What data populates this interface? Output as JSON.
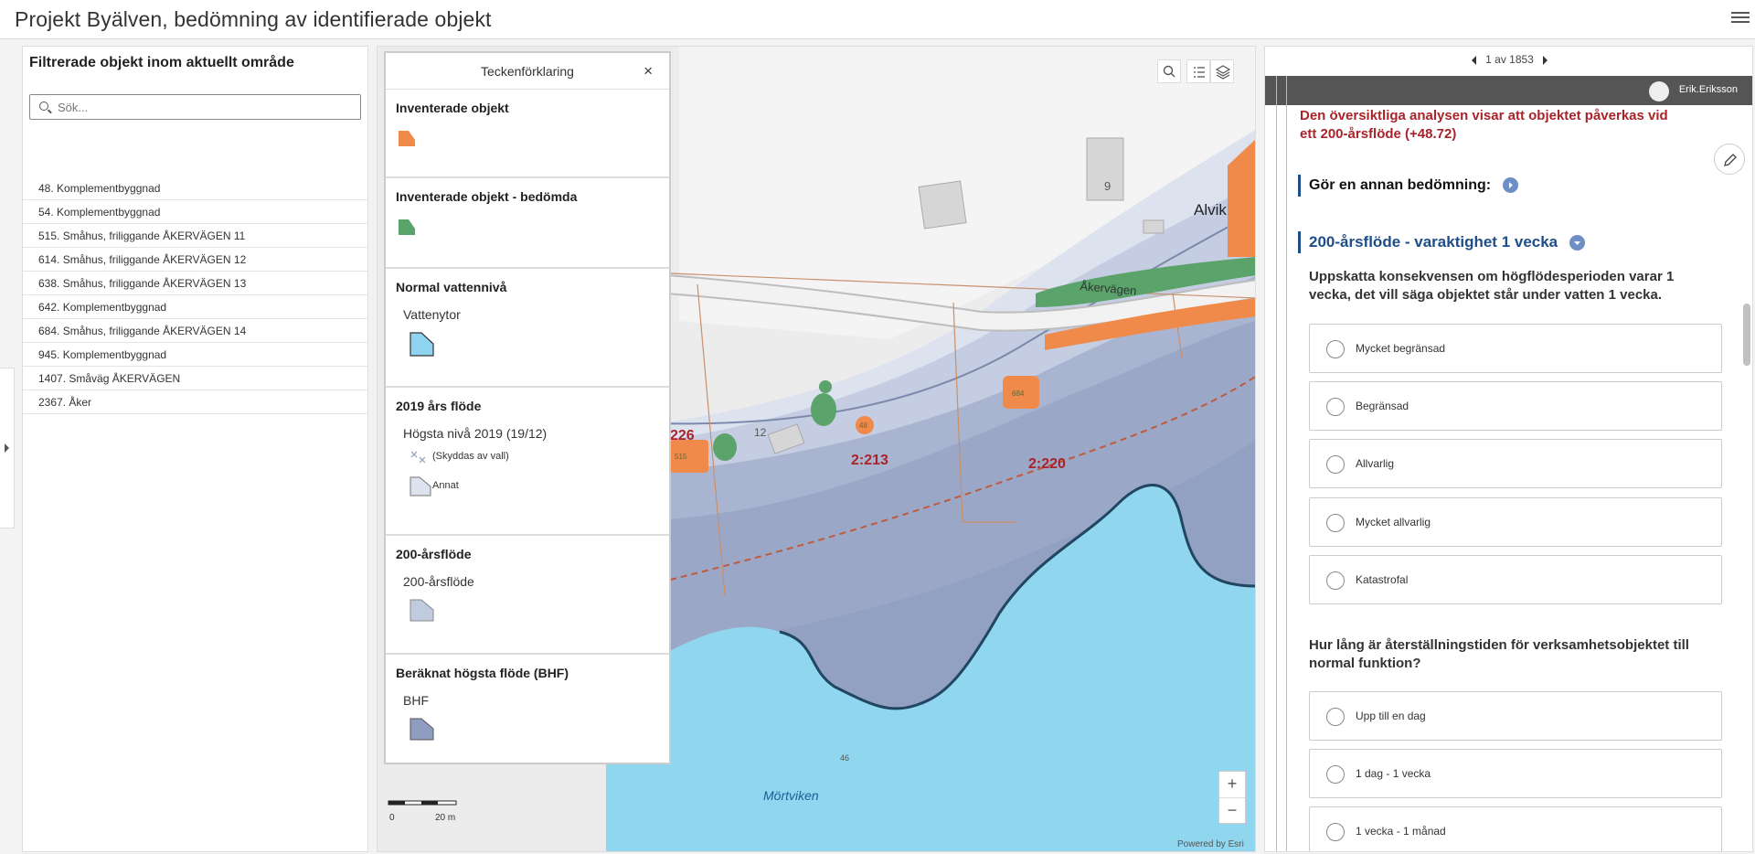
{
  "app": {
    "title": "Projekt Byälven, bedömning av identifierade objekt"
  },
  "list_panel": {
    "title": "Filtrerade objekt inom aktuellt område",
    "search_placeholder": "Sök...",
    "items": [
      "48. Komplementbyggnad",
      "54. Komplementbyggnad",
      "515. Småhus, friliggande ÅKERVÄGEN 11",
      "614. Småhus, friliggande ÅKERVÄGEN 12",
      "638. Småhus, friliggande ÅKERVÄGEN 13",
      "642. Komplementbyggnad",
      "684. Småhus, friliggande ÅKERVÄGEN 14",
      "945. Komplementbyggnad",
      "1407. Småväg ÅKERVÄGEN",
      "2367. Åker"
    ]
  },
  "legend": {
    "title": "Teckenförklaring",
    "close": "×",
    "sections": {
      "s1": {
        "title": "Inventerade objekt",
        "color": "#f08a4b"
      },
      "s2": {
        "title": "Inventerade objekt - bedömda",
        "color": "#5aa36b"
      },
      "s3": {
        "title": "Normal vattennivå",
        "sub": "Vattenytor",
        "color": "#8fd3f0"
      },
      "s4": {
        "title": "2019 års flöde",
        "sub": "Högsta nivå 2019 (19/12)",
        "item1": "(Skyddas av vall)",
        "item2": "Annat"
      },
      "s5": {
        "title": "200-årsflöde",
        "sub": "200-årsflöde",
        "color": "#c0cbe0"
      },
      "s6": {
        "title": "Beräknat högsta flöde (BHF)",
        "sub": "BHF",
        "color": "#8e9dc0"
      }
    }
  },
  "map": {
    "labels": {
      "road": "Åkervägen",
      "place": "Alvik",
      "bay": "Mörtviken",
      "parcel_226": "226",
      "parcel_213": "2:213",
      "parcel_220": "2:220",
      "house_9": "9",
      "house_12": "12",
      "obj_684": "684",
      "obj_48": "48",
      "obj_515": "515",
      "depth_46": "46"
    },
    "scale": {
      "start": "0",
      "end": "20 m"
    },
    "attribution": "Powered by Esri",
    "zoom_in": "+",
    "zoom_out": "−"
  },
  "right_panel": {
    "pager": "1 av 1853",
    "user": "Erik.Eriksson",
    "analysis": "Den översiktliga analysen visar att objektet påverkas vid ett 200-årsflöde (+48.72)",
    "other_assessment": "Gör en annan bedömning:",
    "section_title": "200-årsflöde - varaktighet 1 vecka",
    "q1": "Uppskatta konsekvensen om högflödesperioden varar 1 vecka, det vill säga objektet står under vatten 1 vecka.",
    "q1_options": [
      "Mycket begränsad",
      "Begränsad",
      "Allvarlig",
      "Mycket allvarlig",
      "Katastrofal"
    ],
    "q2": "Hur lång är återställningstiden för verksamhetsobjektet till normal funktion?",
    "q2_options": [
      "Upp till en dag",
      "1 dag - 1 vecka",
      "1 vecka - 1 månad"
    ]
  }
}
